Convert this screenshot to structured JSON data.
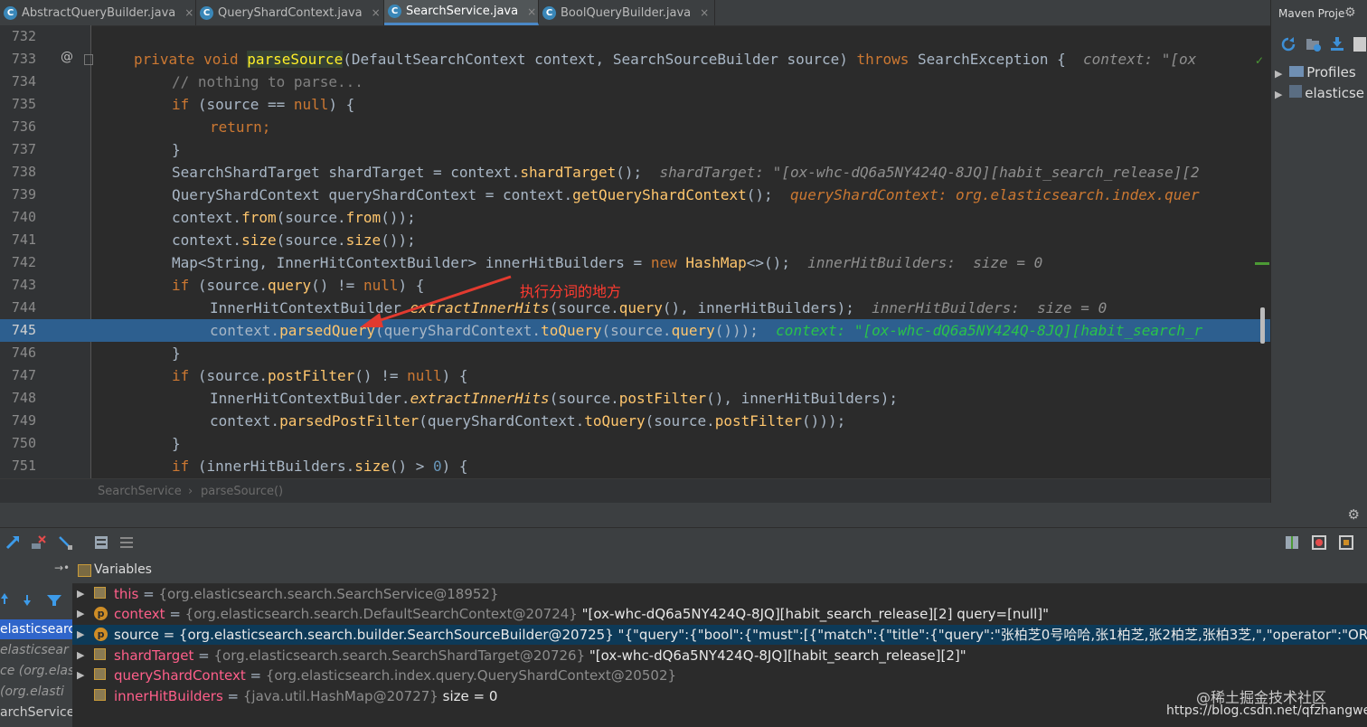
{
  "tabs": [
    {
      "label": "AbstractQueryBuilder.java",
      "icon": "class-icon"
    },
    {
      "label": "QueryShardContext.java",
      "icon": "class-icon"
    },
    {
      "label": "SearchService.java",
      "icon": "class-icon",
      "active": true
    },
    {
      "label": "BoolQueryBuilder.java",
      "icon": "class-icon"
    }
  ],
  "tab_close": "×",
  "icon_letter": "C",
  "editor": {
    "lines": [
      {
        "num": "732",
        "code": ""
      },
      {
        "num": "733",
        "code": "private void parseSource(DefaultSearchContext context, SearchSourceBuilder source) throws SearchException {",
        "hint": "context: \"[ox"
      },
      {
        "num": "734",
        "code": "// nothing to parse..."
      },
      {
        "num": "735",
        "code": "if (source == null) {"
      },
      {
        "num": "736",
        "code": "return;"
      },
      {
        "num": "737",
        "code": "}"
      },
      {
        "num": "738",
        "code": "SearchShardTarget shardTarget = context.shardTarget();",
        "hint": "shardTarget: \"[ox-whc-dQ6a5NY424Q-8JQ][habit_search_release][2"
      },
      {
        "num": "739",
        "code": "QueryShardContext queryShardContext = context.getQueryShardContext();",
        "hint": "queryShardContext: org.elasticsearch.index.quer"
      },
      {
        "num": "740",
        "code": "context.from(source.from());"
      },
      {
        "num": "741",
        "code": "context.size(source.size());"
      },
      {
        "num": "742",
        "code": "Map<String, InnerHitContextBuilder> innerHitBuilders = new HashMap<>();",
        "hint": "innerHitBuilders:  size = 0"
      },
      {
        "num": "743",
        "code": "if (source.query() != null) {"
      },
      {
        "num": "744",
        "code": "InnerHitContextBuilder.extractInnerHits(source.query(), innerHitBuilders);",
        "hint": "innerHitBuilders:  size = 0"
      },
      {
        "num": "745",
        "code": "context.parsedQuery(queryShardContext.toQuery(source.query()));",
        "hint": "context: \"[ox-whc-dQ6a5NY424Q-8JQ][habit_search_r"
      },
      {
        "num": "746",
        "code": "}"
      },
      {
        "num": "747",
        "code": "if (source.postFilter() != null) {"
      },
      {
        "num": "748",
        "code": "InnerHitContextBuilder.extractInnerHits(source.postFilter(), innerHitBuilders);"
      },
      {
        "num": "749",
        "code": "context.parsedPostFilter(queryShardContext.toQuery(source.postFilter()));"
      },
      {
        "num": "750",
        "code": "}"
      },
      {
        "num": "751",
        "code": "if (innerHitBuilders.size() > 0) {"
      }
    ],
    "annotation": "执行分词的地方",
    "override_marker": "@",
    "checkmark": "✓"
  },
  "breadcrumb": {
    "class": "SearchService",
    "separator": "›",
    "method": "parseSource()"
  },
  "maven": {
    "title": "Maven Proje",
    "items": [
      {
        "label": "Profiles"
      },
      {
        "label": "elasticse"
      }
    ],
    "arrow": "▶"
  },
  "gear": "⚙",
  "variables": {
    "title": "Variables",
    "items": [
      {
        "name": "this",
        "value": "{org.elasticsearch.search.SearchService@18952}",
        "extra": "",
        "icon": "list-icon"
      },
      {
        "name": "context",
        "value": "{org.elasticsearch.search.DefaultSearchContext@20724}",
        "extra": "\"[ox-whc-dQ6a5NY424Q-8JQ][habit_search_release][2] query=[null]\"",
        "icon": "p-icon"
      },
      {
        "name": "source",
        "value": "{org.elasticsearch.search.builder.SearchSourceBuilder@20725}",
        "extra": "\"{\"query\":{\"bool\":{\"must\":[{\"match\":{\"title\":{\"query\":\"张柏芝0号哈哈,张1柏芝,张2柏芝,张柏3芝,\",\"operator\":\"OR\",\"anal… Vi",
        "icon": "p-icon",
        "selected": true
      },
      {
        "name": "shardTarget",
        "value": "{org.elasticsearch.search.SearchShardTarget@20726}",
        "extra": "\"[ox-whc-dQ6a5NY424Q-8JQ][habit_search_release][2]\"",
        "icon": "list-icon"
      },
      {
        "name": "queryShardContext",
        "value": "{org.elasticsearch.index.query.QueryShardContext@20502}",
        "extra": "",
        "icon": "list-icon"
      },
      {
        "name": "innerHitBuilders",
        "value": "{java.util.HashMap@20727}",
        "extra": "size = 0",
        "icon": "list-icon"
      }
    ],
    "p_letter": "p",
    "expand": "▶",
    "eq": " = "
  },
  "frames": {
    "items": [
      {
        "label": "elasticsearch",
        "selected": true
      },
      {
        "label": "elasticsear"
      },
      {
        "label": "ce (org.elas"
      },
      {
        "label": "(org.elasti"
      },
      {
        "label": "archService"
      }
    ],
    "pin": "→•"
  },
  "watermark": {
    "line1": "@稀土掘金技术社区",
    "line2": "https://blog.csdn.net/qfzhangwei"
  }
}
